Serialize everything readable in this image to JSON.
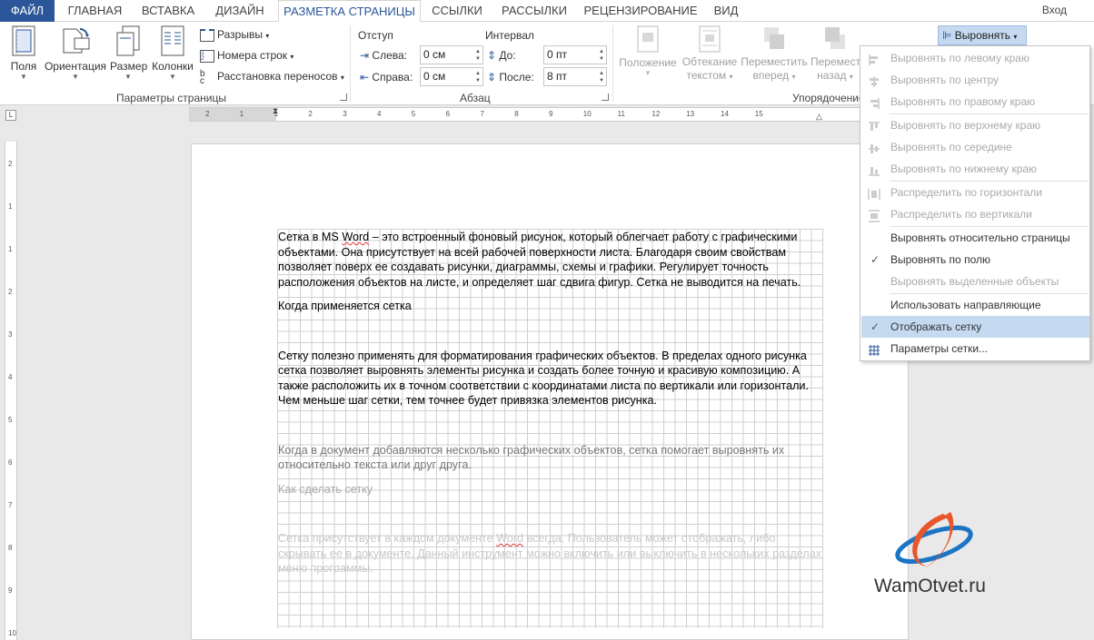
{
  "tabs": [
    "ФАЙЛ",
    "ГЛАВНАЯ",
    "ВСТАВКА",
    "ДИЗАЙН",
    "РАЗМЕТКА СТРАНИЦЫ",
    "ССЫЛКИ",
    "РАССЫЛКИ",
    "РЕЦЕНЗИРОВАНИЕ",
    "ВИД"
  ],
  "signin": "Вход",
  "page_setup": {
    "margins": "Поля",
    "orientation": "Ориентация",
    "size": "Размер",
    "columns": "Колонки",
    "breaks": "Разрывы",
    "line_numbers": "Номера строк",
    "hyphenation": "Расстановка переносов",
    "group_label": "Параметры страницы"
  },
  "paragraph": {
    "indent_label": "Отступ",
    "spacing_label": "Интервал",
    "left_label": "Слева:",
    "left_value": "0 см",
    "right_label": "Справа:",
    "right_value": "0 см",
    "before_label": "До:",
    "before_value": "0 пт",
    "after_label": "После:",
    "after_value": "8 пт",
    "group_label": "Абзац"
  },
  "arrange": {
    "position": "Положение",
    "wrap_line1": "Обтекание",
    "wrap_line2": "текстом",
    "forward_line1": "Переместить",
    "forward_line2": "вперед",
    "backward_line1": "Переместить",
    "backward_line2": "назад",
    "group_label": "Упорядочение",
    "align_button": "Выровнять"
  },
  "align_menu": [
    {
      "label": "Выровнять по левому краю",
      "enabled": false,
      "icon": "align-left-icon"
    },
    {
      "label": "Выровнять по центру",
      "enabled": false,
      "icon": "align-center-icon"
    },
    {
      "label": "Выровнять по правому краю",
      "enabled": false,
      "icon": "align-right-icon"
    },
    {
      "label": "Выровнять по верхнему краю",
      "enabled": false,
      "icon": "align-top-icon"
    },
    {
      "label": "Выровнять по середине",
      "enabled": false,
      "icon": "align-middle-icon"
    },
    {
      "label": "Выровнять по нижнему краю",
      "enabled": false,
      "icon": "align-bottom-icon"
    },
    {
      "label": "Распределить по горизонтали",
      "enabled": false,
      "icon": "distribute-horizontal-icon"
    },
    {
      "label": "Распределить по вертикали",
      "enabled": false,
      "icon": "distribute-vertical-icon"
    },
    {
      "label": "Выровнять относительно страницы",
      "enabled": true,
      "icon": ""
    },
    {
      "label": "Выровнять по полю",
      "enabled": true,
      "checked": true,
      "icon": ""
    },
    {
      "label": "Выровнять выделенные объекты",
      "enabled": false,
      "icon": ""
    },
    {
      "label": "Использовать направляющие",
      "enabled": true,
      "icon": ""
    },
    {
      "label": "Отображать сетку",
      "enabled": true,
      "checked": true,
      "highlighted": true,
      "icon": ""
    },
    {
      "label": "Параметры сетки...",
      "enabled": true,
      "icon": "grid-icon"
    }
  ],
  "ruler": {
    "h_numbers": [
      "2",
      "1",
      "1",
      "2",
      "3",
      "4",
      "5",
      "6",
      "7",
      "8",
      "9",
      "10",
      "11",
      "12",
      "13",
      "14",
      "15"
    ],
    "v_numbers": [
      "2",
      "1",
      "1",
      "2",
      "3",
      "4",
      "5",
      "6",
      "7",
      "8",
      "9",
      "10"
    ]
  },
  "document": {
    "p1_start": "Сетка в MS ",
    "p1_word": "Word",
    "p1_rest": " – это встроенный фоновый рисунок, который облегчает работу с графическими объектами. Она присутствует на всей рабочей поверхности листа. Благодаря своим свойствам позволяет поверх ее создавать рисунки, диаграммы, схемы и графики. Регулирует точность расположения объектов на листе, и определяет шаг сдвига фигур. Сетка не выводится на печать.",
    "h1": "Когда применяется сетка",
    "p2": "Сетку полезно применять для форматирования графических объектов. В пределах одного рисунка сетка позволяет выровнять элементы рисунка и создать более точную и красивую композицию. А также расположить их в точном соответствии с координатами листа по вертикали или горизонтали. Чем меньше шаг сетки, тем точнее будет привязка элементов рисунка.",
    "p3": "Когда в документ добавляются несколько графических объектов, сетка помогает выровнять их относительно текста или друг друга.",
    "h2": "Как сделать сетку",
    "p4_start": "Сетка присутствует в каждом документе ",
    "p4_word": "Word",
    "p4_rest": " всегда. Пользователь может отображать, либо скрывать ее в документе. Данный инструмент можно включить или выключить в нескольких разделах меню программы."
  },
  "watermark": "WamOtvet.ru",
  "colors": {
    "accent": "#2b579a",
    "highlight": "#c5daf1",
    "logo_orange": "#e8562a",
    "logo_blue": "#1c74c4"
  }
}
